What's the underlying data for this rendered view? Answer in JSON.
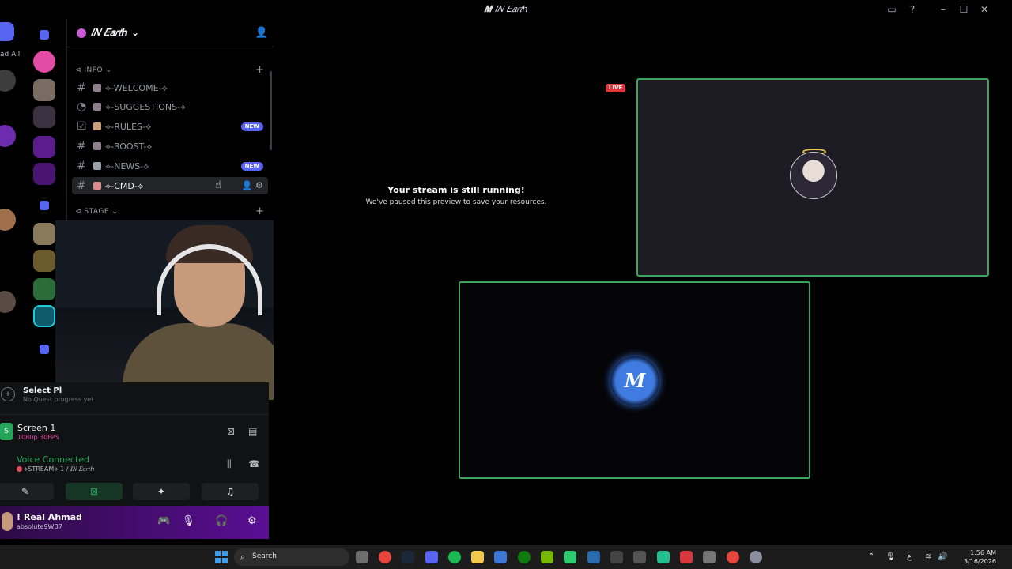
{
  "window": {
    "title": "𝐼𝑁 𝐸𝑎𝑟𝑡ℎ",
    "title_mark": "𝑴"
  },
  "rail": {
    "read_all_label": "ad All"
  },
  "guild": {
    "name": "𝐼𝑁 𝐸𝑎𝑟𝑡ℎ",
    "chevron": "⌄"
  },
  "categories": [
    {
      "name": "⊲ INFO ⌄"
    },
    {
      "name": "⊲ STAGE ⌄"
    }
  ],
  "channels": [
    {
      "name": "⟡-WELCOME-⟡",
      "badge": ""
    },
    {
      "name": "⟡-SUGGESTIONS-⟡",
      "badge": ""
    },
    {
      "name": "⟡-RULES-⟡",
      "badge": "NEW"
    },
    {
      "name": "⟡-BOOST-⟡",
      "badge": ""
    },
    {
      "name": "⟡-NEWS-⟡",
      "badge": "NEW"
    },
    {
      "name": "⟡-CMD-⟡",
      "badge": ""
    }
  ],
  "quest": {
    "title": "Select Pl",
    "subtitle": "No Quest progress yet"
  },
  "stream": {
    "title": "Screen 1",
    "quality": "1080p 30FPS"
  },
  "voice": {
    "status": "Voice Connected",
    "channel": "⟡STREAM⟡ 1 / 𝐼𝑁 𝐸𝑎𝑟𝑡ℎ"
  },
  "user": {
    "name": "! Real Ahmad",
    "status": "absolute9WB7"
  },
  "stage": {
    "paused_title": "Your stream is still running!",
    "paused_subtitle": "We've paused this preview to save your resources.",
    "live_label": "LIVE",
    "logo_text": "𝑴"
  },
  "taskbar": {
    "search_label": "Search",
    "time": "1:56 AM",
    "date": "3/16/2026",
    "lang": "ع"
  },
  "colors": {
    "accent": "#5865f2",
    "online_green": "#23a55a",
    "tile_border": "#3ba55d",
    "live_red": "#da373c",
    "user_panel": "#5a0e94"
  }
}
